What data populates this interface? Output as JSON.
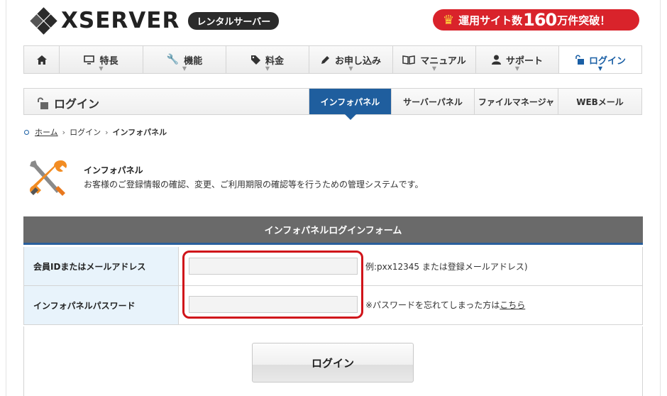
{
  "header": {
    "logo_text": "XSERVER",
    "logo_badge": "レンタルサーバー",
    "promo_prefix": "運用サイト数",
    "promo_number": "160",
    "promo_suffix": "万件突破！"
  },
  "mainnav": {
    "home_icon": "home-icon",
    "items": [
      {
        "label": "特長",
        "icon": "monitor-icon"
      },
      {
        "label": "機能",
        "icon": "wrench-icon"
      },
      {
        "label": "料金",
        "icon": "tag-icon"
      },
      {
        "label": "お申し込み",
        "icon": "pen-icon"
      },
      {
        "label": "マニュアル",
        "icon": "book-icon"
      },
      {
        "label": "サポート",
        "icon": "user-icon"
      },
      {
        "label": "ログイン",
        "icon": "unlock-icon",
        "active": true
      }
    ]
  },
  "subbar": {
    "title": "ログイン",
    "tabs": [
      "インフォパネル",
      "サーバーパネル",
      "ファイルマネージャ",
      "WEBメール"
    ],
    "active_tab": "インフォパネル"
  },
  "breadcrumb": {
    "home": "ホーム",
    "login": "ログイン",
    "current": "インフォパネル"
  },
  "intro": {
    "title": "インフォパネル",
    "description": "お客様のご登録情報の確認、変更、ご利用期限の確認等を行うための管理システムです。"
  },
  "form": {
    "heading": "インフォパネルログインフォーム",
    "id_label": "会員IDまたはメールアドレス",
    "id_value": "",
    "id_hint": "例:pxx12345 または登録メールアドレス)",
    "password_label": "インフォパネルパスワード",
    "password_value": "",
    "password_hint": "※パスワードを忘れてしまった方は",
    "password_hint_link": "こちら",
    "submit_label": "ログイン"
  },
  "colors": {
    "accent_blue": "#1f5e9e",
    "promo_red": "#d9232b",
    "highlight_red": "#d0141a",
    "label_bg": "#e8f3fb"
  }
}
